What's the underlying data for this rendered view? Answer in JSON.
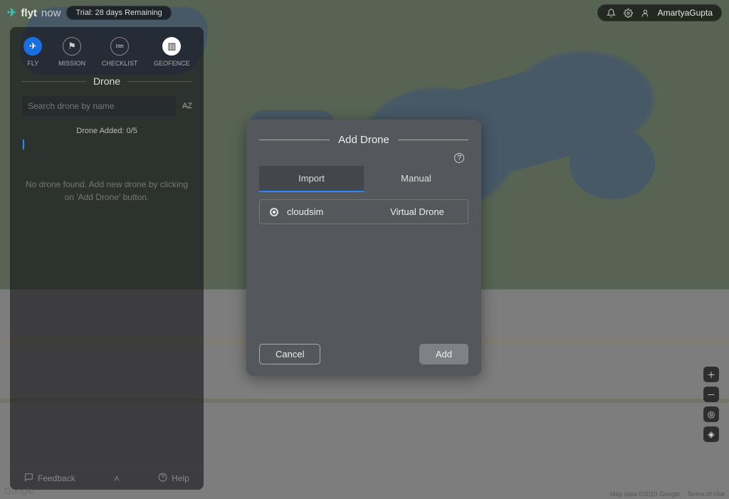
{
  "brand": {
    "flyt": "flyt",
    "now": "now"
  },
  "trial": "Trial: 28 days Remaining",
  "user": {
    "name": "AmartyaGupta"
  },
  "tabs": {
    "fly": "FLY",
    "mission": "MISSION",
    "checklist": "CHECKLIST",
    "geofence": "GEOFENCE"
  },
  "panel": {
    "title": "Drone",
    "search_placeholder": "Search drone by name",
    "sort": "AZ",
    "count": "Drone Added: 0/5",
    "empty": "No drone found. Add new drone by clicking on 'Add Drone' button."
  },
  "footer": {
    "feedback": "Feedback",
    "help": "Help"
  },
  "modal": {
    "title": "Add Drone",
    "tab_import": "Import",
    "tab_manual": "Manual",
    "row": {
      "name": "cloudsim",
      "type": "Virtual Drone"
    },
    "cancel": "Cancel",
    "add": "Add"
  },
  "map": {
    "attribution": "Map data ©2020 Google",
    "terms": "Terms of Use",
    "mark": "Google"
  }
}
